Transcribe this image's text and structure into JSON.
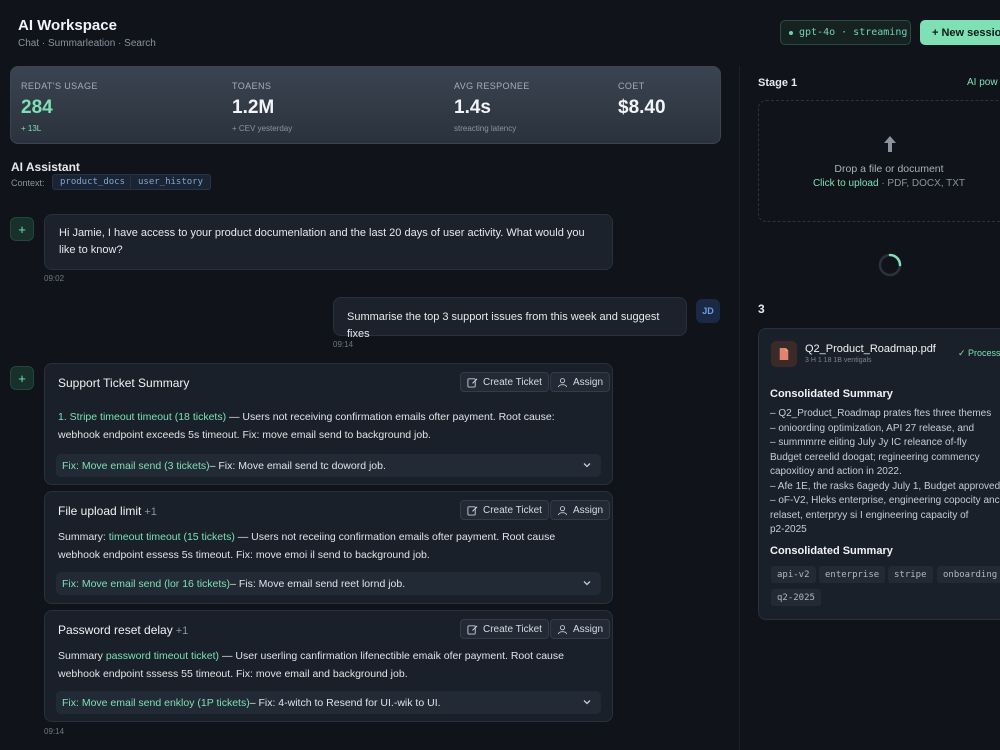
{
  "app": {
    "title": "AI Workspace",
    "subtitle": "Chat · Summarleation · Search"
  },
  "header": {
    "model_chip": "gpt-4o · streaming",
    "new_session": "+ New session"
  },
  "stats": [
    {
      "label": "REDAT'S USAGE",
      "value": "284",
      "sub": "+ 13L"
    },
    {
      "label": "TOAENS",
      "value": "1.2M",
      "sub": "+ CEV yesterday"
    },
    {
      "label": "AVG RESPONEE",
      "value": "1.4s",
      "sub": "streacting latency"
    },
    {
      "label": "COET",
      "value": "$8.40",
      "sub": ""
    }
  ],
  "assistant": {
    "title": "AI Assistant",
    "context_label": "Context:",
    "context_chips": [
      "product_docs",
      "user_history"
    ]
  },
  "messages": {
    "ai_intro": "Hi Jamie, I have access to your product documenlation and the last 20 days of user activity. What would you like to know?",
    "ai_intro_time": "09:02",
    "user_text": "Summarise the top 3 support issues from this week and suggest fixes",
    "user_initials": "JD",
    "user_time": "09:14",
    "final_time": "09:14"
  },
  "cards": [
    {
      "title": "Support Ticket Summary",
      "count": "",
      "create_label": "Create Ticket",
      "assign_label": "Assign",
      "body_hl": "1. Stripe timeout timeout (18 tickets)",
      "body_rest": " — Users not receiving confirmation emails ofter payment. Root cause: webhook endpoint exceeds 5s timeout. Fix: move email send to background job.",
      "fix_hl": "Fix: Move email send (3 tickets)",
      "fix_rest": " – Fix: Move email send tc doword job."
    },
    {
      "title": "File upload limit",
      "count": "+1",
      "create_label": "Create Ticket",
      "assign_label": "Assign",
      "body_pre": "Summary: ",
      "body_hl": "timeout timeout (15 tickets)",
      "body_rest": " — Users not receiing confirmation emails ofter payment. Root cause webhook endpoint essess 5s timeout. Fix: move emoi il send to background job.",
      "fix_hl": "Fix: Move email send (lor 16 tickets)",
      "fix_rest": " – Fis: Move email send reet lornd job."
    },
    {
      "title": "Password reset delay",
      "count": "+1",
      "create_label": "Create Ticket",
      "assign_label": "Assign",
      "body_pre": "Summary ",
      "body_hl": "password timeout ticket)",
      "body_rest": " — User userling canfirmation lifenectible emaik ofer payment. Root cause webhook endpoint sssess 55 timeout. Fix: move email and background job.",
      "fix_hl": "Fix: Move email send enkloy (1P tickets)",
      "fix_rest": " – Fix: 4-witch to Resend for UI.-wik to UI."
    }
  ],
  "right_panel": {
    "stage_label": "Stage 1",
    "ai_pow": "AI pow",
    "drop_title": "Drop a file or document",
    "drop_click": "Click to upload",
    "drop_types": " · PDF, DOCX, TXT",
    "step_number": "3",
    "file_name": "Q2_Product_Roadmap.pdf",
    "file_meta": "3 H 1 18 1B ventigals",
    "file_status": "✓ Process",
    "summary_title": "Consolidated Summary",
    "summary_lines": [
      "– Q2_Product_Roadmap prates ftes three themes",
      "– onioording optimization, API 27 release, and",
      "– summmrre eiiting July Jy IC releance of-fly",
      "   Budget cereelid doogat; regineering commency",
      "   capoxitioy and action in 2022.",
      "– Afe 1E, the rasks 6agedy July 1, Budget approved",
      "– oF-V2, Hleks enterprise, engineering copocity anc",
      "   relaset, enterpryy si I engineering capacity of",
      "   p2-2025"
    ],
    "summary_title_2": "Consolidated Summary",
    "tags": [
      "api-v2",
      "enterprise",
      "stripe",
      "onboarding",
      "q2-2025"
    ]
  },
  "colors": {
    "accent": "#7ee0b4",
    "background": "#10141a",
    "card": "#1a2029",
    "user_accent": "#6e9be6"
  },
  "icons": [
    "plus-icon",
    "edit-icon",
    "user-icon",
    "chevron-down-icon",
    "upload-arrow-icon",
    "spinner-icon",
    "file-pdf-icon",
    "check-icon"
  ]
}
